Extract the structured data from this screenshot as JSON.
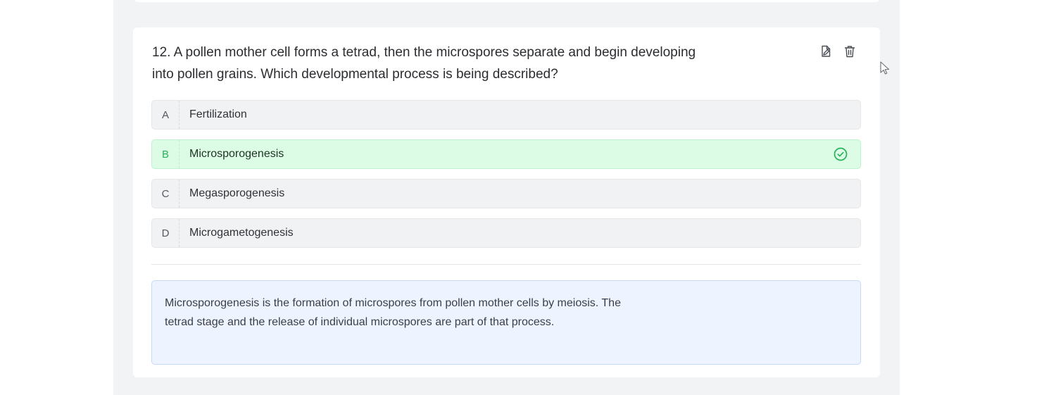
{
  "question": {
    "text": "12. A pollen mother cell forms a tetrad, then the microspores separate and begin developing into pollen grains. Which developmental process is being described?"
  },
  "actions": {
    "edit_icon": "edit-document-icon",
    "delete_icon": "trash-icon"
  },
  "options": [
    {
      "letter": "A",
      "text": "Fertilization",
      "correct": false
    },
    {
      "letter": "B",
      "text": "Microsporogenesis",
      "correct": true
    },
    {
      "letter": "C",
      "text": "Megasporogenesis",
      "correct": false
    },
    {
      "letter": "D",
      "text": "Microgametogenesis",
      "correct": false
    }
  ],
  "explanation": {
    "text": "Microsporogenesis is the formation of microspores from pollen mother cells by meiosis. The tetrad stage and the release of individual microspores are part of that process."
  },
  "colors": {
    "correct_bg": "#dcfce6",
    "correct_accent": "#27b35a",
    "explanation_bg": "#eef4ff",
    "explanation_border": "#c6daf8",
    "panel_bg": "#f1f3f4"
  }
}
